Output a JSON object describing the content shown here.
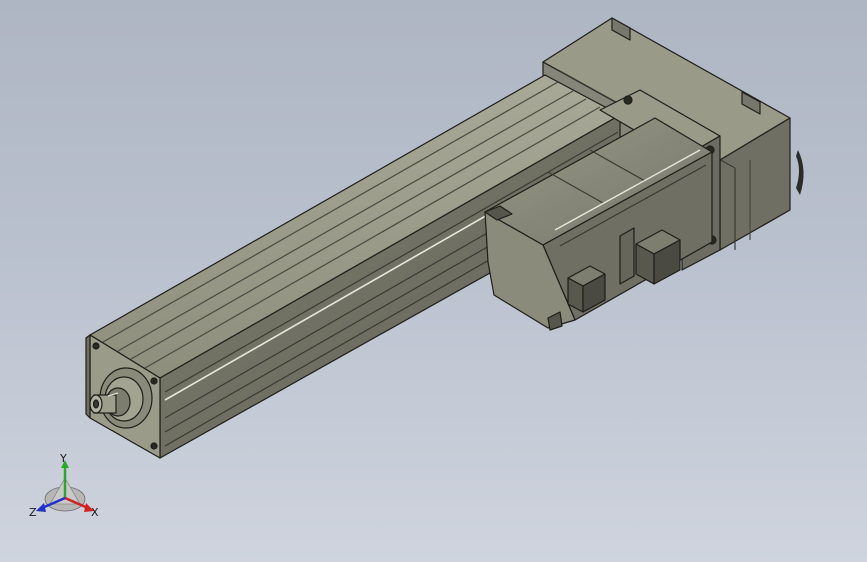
{
  "model": {
    "parts": [
      "linear-actuator-body",
      "drive-housing",
      "servo-motor",
      "output-shaft"
    ],
    "colors": {
      "background_top": "#aeb5c3",
      "background_bottom": "#cfd4de",
      "metal_light": "#a7a795",
      "metal_mid": "#8c8c7b",
      "metal_dark": "#5f5f52",
      "edge": "#1e1e1a"
    }
  },
  "triad": {
    "x_label": "X",
    "y_label": "Y",
    "z_label": "Z",
    "x_color": "#d42020",
    "y_color": "#2aa82a",
    "z_color": "#2030c8"
  }
}
